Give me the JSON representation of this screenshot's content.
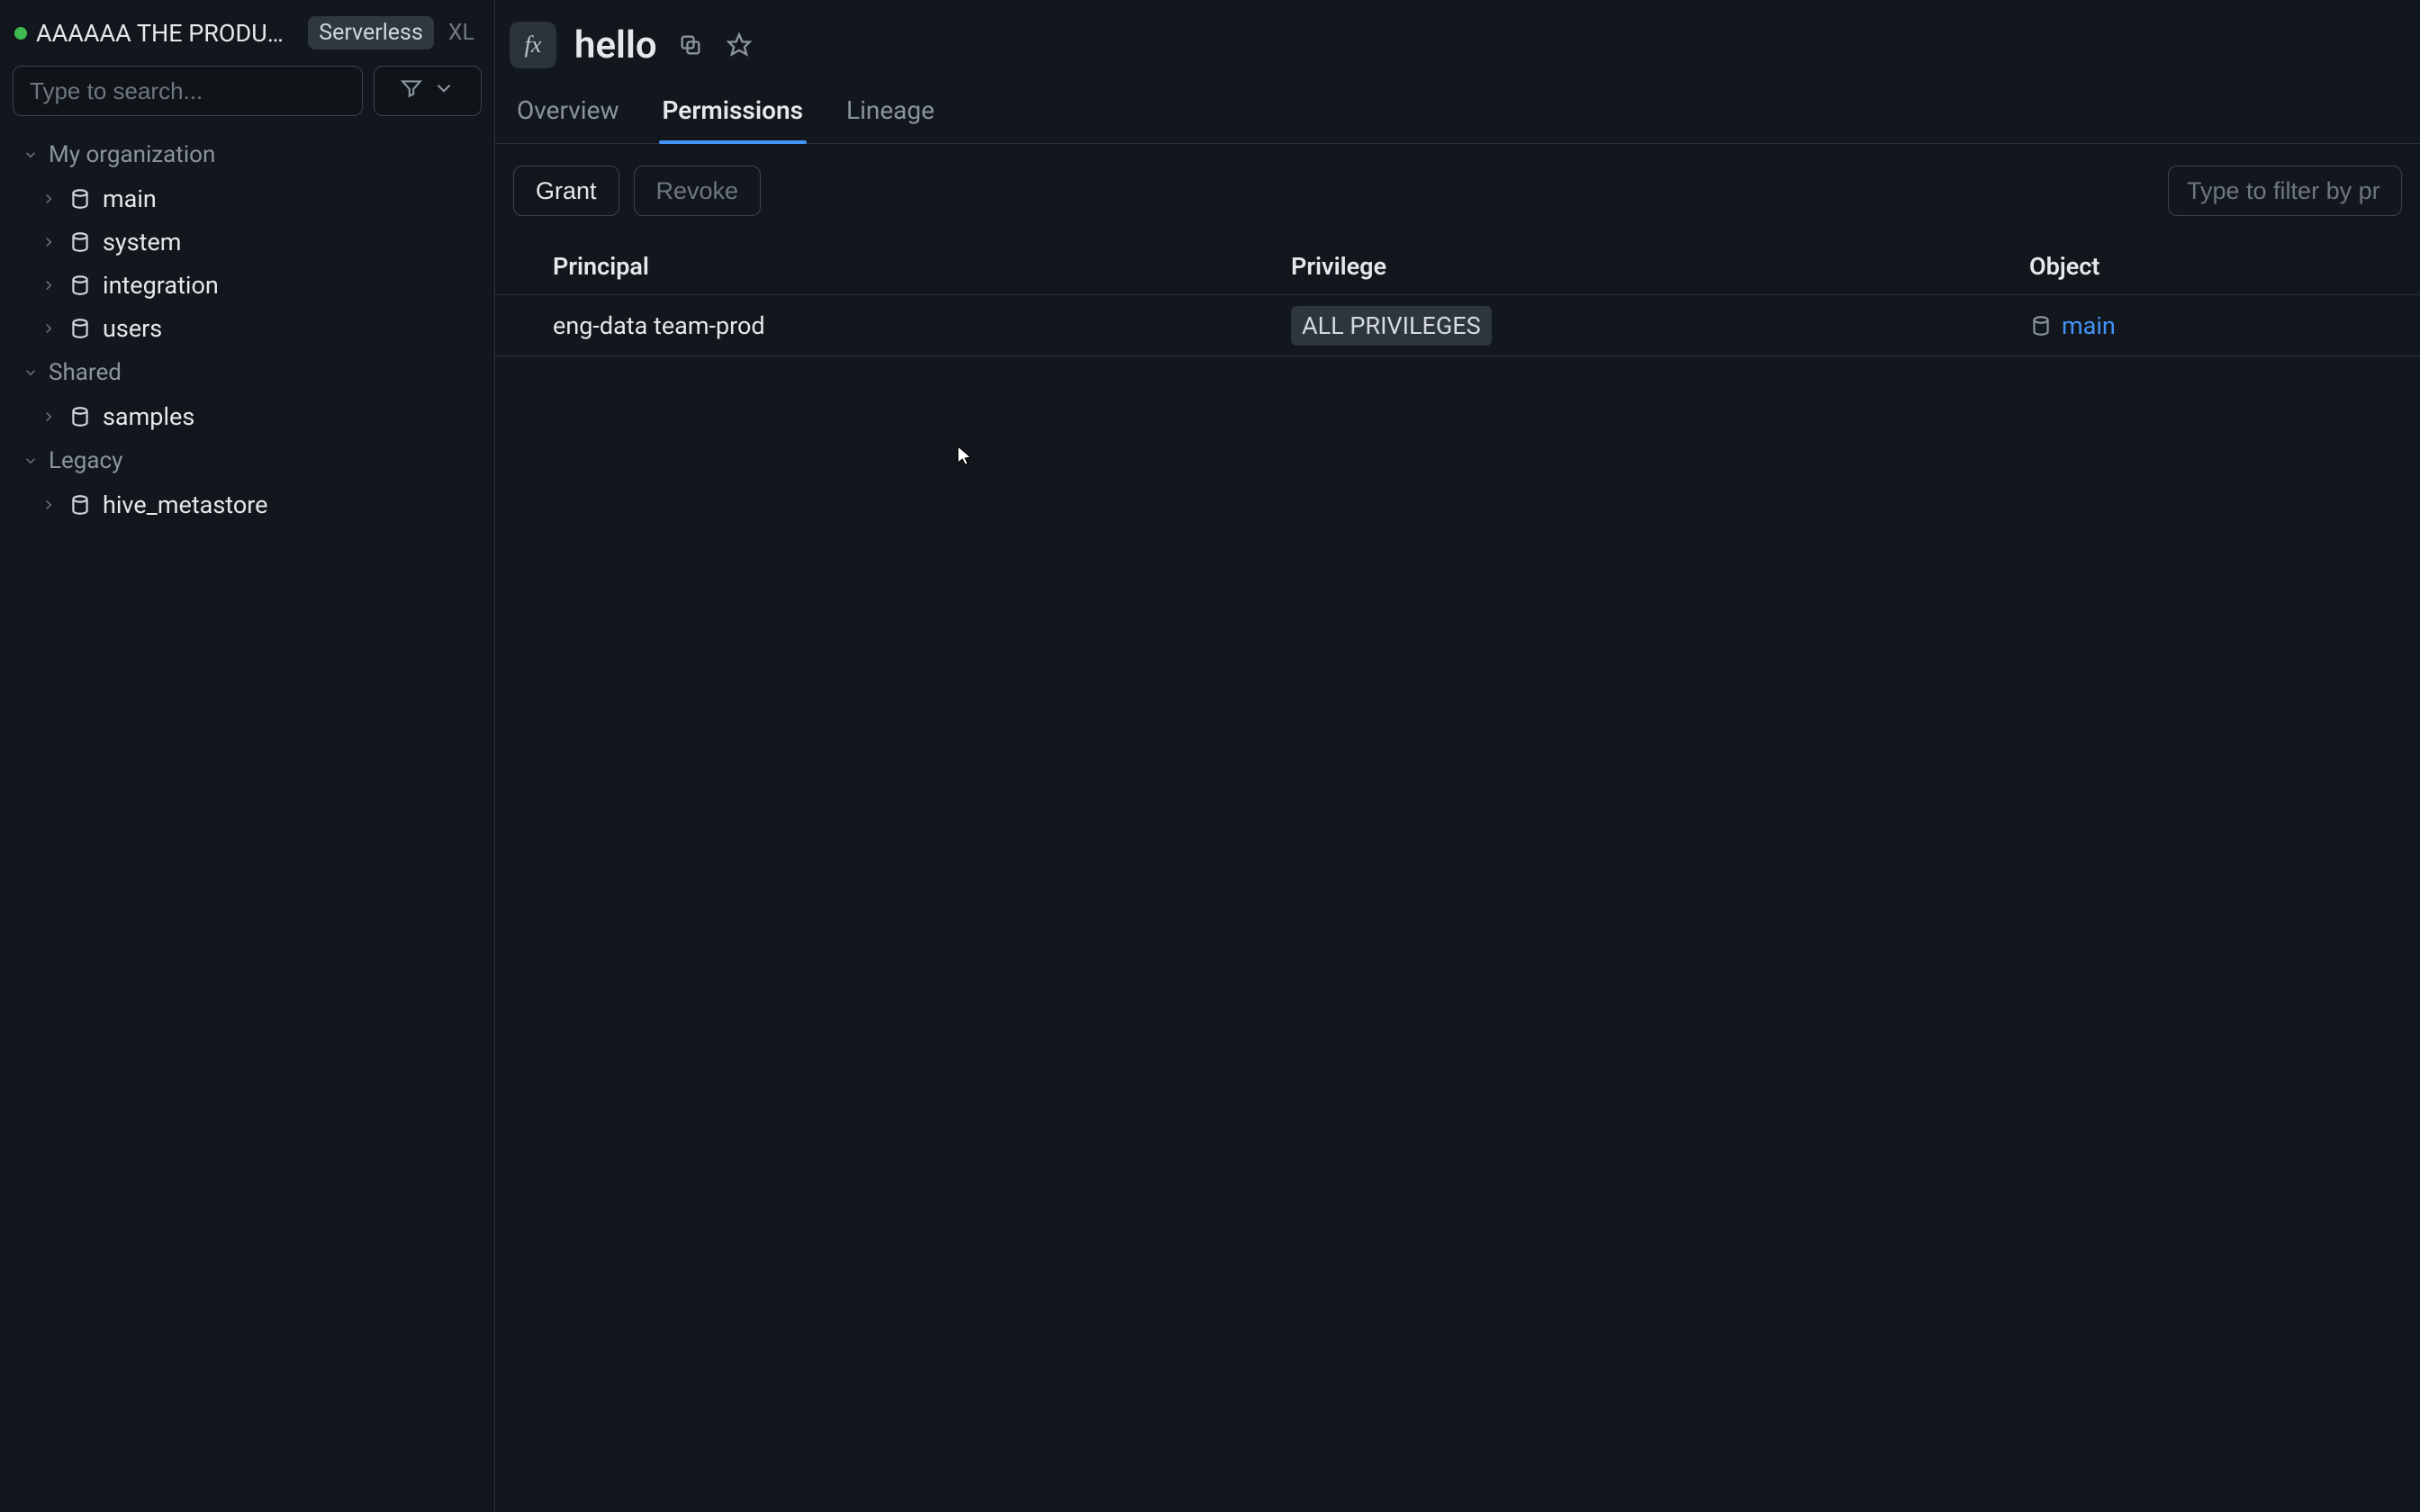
{
  "sidebar": {
    "workspace_name": "AAAAAA THE PRODU…",
    "compute_chip": "Serverless",
    "size_chip": "XL",
    "search_placeholder": "Type to search...",
    "sections": [
      {
        "label": "My organization",
        "expanded": true,
        "items": [
          {
            "label": "main"
          },
          {
            "label": "system"
          },
          {
            "label": "integration"
          },
          {
            "label": "users"
          }
        ]
      },
      {
        "label": "Shared",
        "expanded": true,
        "items": [
          {
            "label": "samples"
          }
        ]
      },
      {
        "label": "Legacy",
        "expanded": true,
        "items": [
          {
            "label": "hive_metastore"
          }
        ]
      }
    ]
  },
  "header": {
    "fx_label": "fx",
    "title": "hello"
  },
  "tabs": [
    {
      "label": "Overview",
      "active": false
    },
    {
      "label": "Permissions",
      "active": true
    },
    {
      "label": "Lineage",
      "active": false
    }
  ],
  "toolbar": {
    "grant_label": "Grant",
    "revoke_label": "Revoke",
    "filter_placeholder": "Type to filter by pr"
  },
  "table": {
    "columns": [
      "Principal",
      "Privilege",
      "Object"
    ],
    "rows": [
      {
        "principal": "eng-data team-prod",
        "privilege": "ALL PRIVILEGES",
        "object": "main"
      }
    ]
  }
}
